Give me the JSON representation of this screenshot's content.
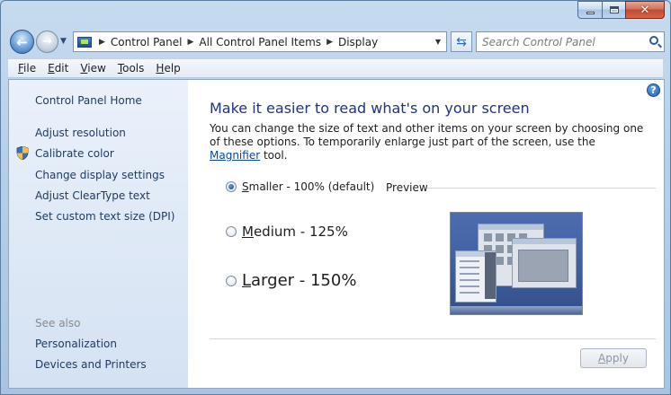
{
  "window": {
    "minimize_glyph": "",
    "close_glyph": "✕"
  },
  "nav": {
    "breadcrumbs": [
      "Control Panel",
      "All Control Panel Items",
      "Display"
    ],
    "search_placeholder": "Search Control Panel"
  },
  "menu": {
    "items": [
      {
        "label": "File",
        "accel": "F",
        "rest": "ile"
      },
      {
        "label": "Edit",
        "accel": "E",
        "rest": "dit"
      },
      {
        "label": "View",
        "accel": "V",
        "rest": "iew"
      },
      {
        "label": "Tools",
        "accel": "T",
        "rest": "ools"
      },
      {
        "label": "Help",
        "accel": "H",
        "rest": "elp"
      }
    ]
  },
  "sidebar": {
    "home": "Control Panel Home",
    "links": [
      "Adjust resolution",
      "Calibrate color",
      "Change display settings",
      "Adjust ClearType text",
      "Set custom text size (DPI)"
    ],
    "see_also_heading": "See also",
    "see_also": [
      "Personalization",
      "Devices and Printers"
    ]
  },
  "main": {
    "title": "Make it easier to read what's on your screen",
    "description_1": "You can change the size of text and other items on your screen by choosing one of these options. To temporarily enlarge just part of the screen, use the ",
    "description_link": "Magnifier",
    "description_2": " tool.",
    "options": [
      {
        "accel": "S",
        "rest": "maller - 100% (default)",
        "checked": true
      },
      {
        "accel": "M",
        "rest": "edium - 125%",
        "checked": false
      },
      {
        "accel": "L",
        "rest": "arger - 150%",
        "checked": false
      }
    ],
    "preview_label": "Preview",
    "apply": {
      "accel": "A",
      "rest": "pply",
      "enabled": false
    }
  },
  "colors": {
    "title": "#1e3287",
    "link": "#0645ad",
    "sidebar_link": "#1e395b"
  }
}
